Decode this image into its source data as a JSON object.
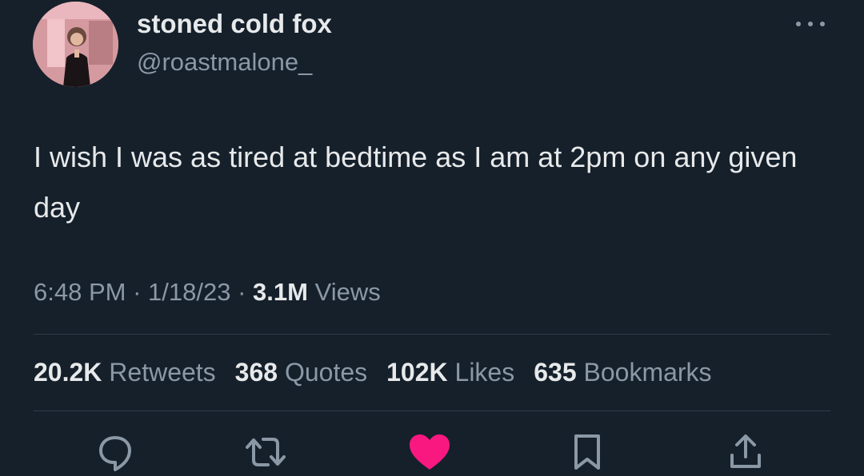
{
  "author": {
    "display_name": "stoned cold fox",
    "handle": "@roastmalone_"
  },
  "tweet": {
    "text": "I wish I was as tired at bedtime as I am at 2pm on any given day"
  },
  "meta": {
    "time": "6:48 PM",
    "separator": "·",
    "date": "1/18/23",
    "views_count": "3.1M",
    "views_label": "Views"
  },
  "stats": {
    "retweets_count": "20.2K",
    "retweets_label": "Retweets",
    "quotes_count": "368",
    "quotes_label": "Quotes",
    "likes_count": "102K",
    "likes_label": "Likes",
    "bookmarks_count": "635",
    "bookmarks_label": "Bookmarks"
  },
  "icons": {
    "more": "more-horizontal-icon",
    "reply": "reply-icon",
    "retweet": "retweet-icon",
    "like": "heart-icon",
    "bookmark": "bookmark-icon",
    "share": "share-icon"
  },
  "colors": {
    "background": "#15202b",
    "text_primary": "#e7e9ea",
    "text_secondary": "#8b98a5",
    "like_active": "#f91880"
  }
}
